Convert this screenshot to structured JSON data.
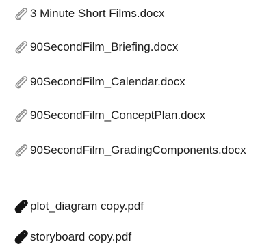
{
  "attachments": [
    {
      "name": "3 Minute Short Films.docx",
      "icon": "paperclip-light-icon"
    },
    {
      "name": "90SecondFilm_Briefing.docx",
      "icon": "paperclip-light-icon"
    },
    {
      "name": "90SecondFilm_Calendar.docx",
      "icon": "paperclip-light-icon"
    },
    {
      "name": "90SecondFilm_ConceptPlan.docx",
      "icon": "paperclip-light-icon"
    },
    {
      "name": "90SecondFilm_GradingComponents.docx",
      "icon": "paperclip-light-icon"
    },
    {
      "name": "plot_diagram copy.pdf",
      "icon": "paperclip-dark-icon"
    },
    {
      "name": "storyboard copy.pdf",
      "icon": "paperclip-dark-icon"
    }
  ],
  "colors": {
    "text": "#1c1c1c",
    "icon_light": "#8e8e8e",
    "icon_dark": "#151515",
    "background": "#ffffff"
  }
}
